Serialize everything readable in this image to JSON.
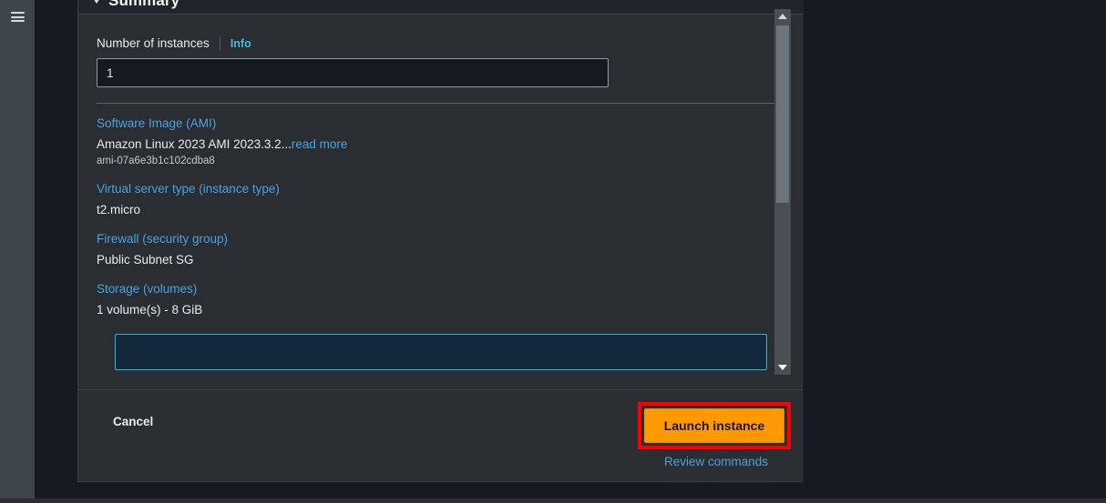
{
  "sidebar": {
    "menu_icon": "hamburger-menu-icon"
  },
  "panel": {
    "title": "Summary",
    "collapse_icon": "chevron-down-icon"
  },
  "instances_field": {
    "label": "Number of instances",
    "info_label": "Info",
    "value": "1"
  },
  "summary_items": [
    {
      "heading": "Software Image (AMI)",
      "value": "Amazon Linux 2023 AMI 2023.3.2...",
      "value_link": "read more",
      "sub": "ami-07a6e3b1c102cdba8"
    },
    {
      "heading": "Virtual server type (instance type)",
      "value": "t2.micro",
      "sub": ""
    },
    {
      "heading": "Firewall (security group)",
      "value": "Public Subnet SG",
      "sub": ""
    },
    {
      "heading": "Storage (volumes)",
      "value": "1 volume(s) - 8 GiB",
      "sub": ""
    }
  ],
  "scrollbar": {
    "up_icon": "scroll-up-arrow-icon",
    "down_icon": "scroll-down-arrow-icon"
  },
  "footer": {
    "cancel_label": "Cancel",
    "launch_label": "Launch instance",
    "review_label": "Review commands"
  },
  "colors": {
    "page_bg": "#161a23",
    "panel_bg": "#2a2e33",
    "sidebar_bg": "#3f454d",
    "link": "#4aa3df",
    "accent_orange": "#ff9900",
    "highlight_red": "#ff0000",
    "info_cyan": "#44b9d6"
  }
}
